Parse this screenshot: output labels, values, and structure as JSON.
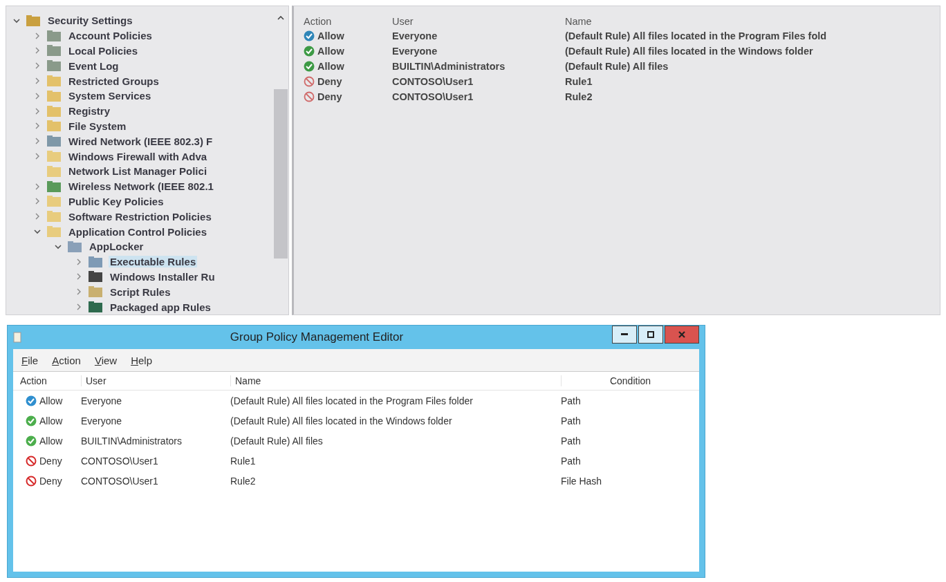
{
  "tree": {
    "items": [
      {
        "label": "Security Settings",
        "kind": "root",
        "expandable": true,
        "expanded": true,
        "selected": false,
        "children": [
          {
            "label": "Account Policies",
            "kind": "policy",
            "expandable": true,
            "expanded": false,
            "selected": false
          },
          {
            "label": "Local Policies",
            "kind": "policy",
            "expandable": true,
            "expanded": false,
            "selected": false
          },
          {
            "label": "Event Log",
            "kind": "policy",
            "expandable": true,
            "expanded": false,
            "selected": false
          },
          {
            "label": "Restricted Groups",
            "kind": "locked-folder",
            "expandable": true,
            "expanded": false,
            "selected": false
          },
          {
            "label": "System Services",
            "kind": "locked-folder",
            "expandable": true,
            "expanded": false,
            "selected": false
          },
          {
            "label": "Registry",
            "kind": "locked-folder",
            "expandable": true,
            "expanded": false,
            "selected": false
          },
          {
            "label": "File System",
            "kind": "locked-folder",
            "expandable": true,
            "expanded": false,
            "selected": false
          },
          {
            "label": "Wired Network (IEEE 802.3) F",
            "kind": "network",
            "expandable": true,
            "expanded": false,
            "selected": false
          },
          {
            "label": "Windows Firewall with Adva",
            "kind": "folder",
            "expandable": true,
            "expanded": false,
            "selected": false
          },
          {
            "label": "Network List Manager Polici",
            "kind": "folder",
            "expandable": false,
            "expanded": false,
            "selected": false
          },
          {
            "label": "Wireless Network (IEEE 802.1",
            "kind": "wireless",
            "expandable": true,
            "expanded": false,
            "selected": false
          },
          {
            "label": "Public Key Policies",
            "kind": "folder",
            "expandable": true,
            "expanded": false,
            "selected": false
          },
          {
            "label": "Software Restriction Policies",
            "kind": "folder",
            "expandable": true,
            "expanded": false,
            "selected": false
          },
          {
            "label": "Application Control Policies",
            "kind": "folder",
            "expandable": true,
            "expanded": true,
            "selected": false,
            "children": [
              {
                "label": "AppLocker",
                "kind": "applocker",
                "expandable": true,
                "expanded": true,
                "selected": false,
                "children": [
                  {
                    "label": "Executable Rules",
                    "kind": "window",
                    "expandable": true,
                    "expanded": false,
                    "selected": true
                  },
                  {
                    "label": "Windows Installer Ru",
                    "kind": "disc",
                    "expandable": true,
                    "expanded": false,
                    "selected": false
                  },
                  {
                    "label": "Script Rules",
                    "kind": "script",
                    "expandable": true,
                    "expanded": false,
                    "selected": false
                  },
                  {
                    "label": "Packaged app Rules",
                    "kind": "package",
                    "expandable": true,
                    "expanded": false,
                    "selected": false
                  }
                ]
              }
            ]
          }
        ]
      }
    ]
  },
  "rule_list": {
    "columns": [
      "Action",
      "User",
      "Name"
    ],
    "rows": [
      {
        "action": "Allow",
        "kind": "allow",
        "color": "#2f86b8",
        "user": "Everyone",
        "name": "(Default Rule) All files located in the Program Files fold"
      },
      {
        "action": "Allow",
        "kind": "allow",
        "color": "#3d9a45",
        "user": "Everyone",
        "name": "(Default Rule) All files located in the Windows folder"
      },
      {
        "action": "Allow",
        "kind": "allow",
        "color": "#3d9a45",
        "user": "BUILTIN\\Administrators",
        "name": "(Default Rule) All files"
      },
      {
        "action": "Deny",
        "kind": "deny",
        "color": "#d06a6a",
        "user": "CONTOSO\\User1",
        "name": "Rule1"
      },
      {
        "action": "Deny",
        "kind": "deny",
        "color": "#d06a6a",
        "user": "CONTOSO\\User1",
        "name": "Rule2"
      }
    ]
  },
  "window": {
    "title": "Group Policy Management Editor",
    "menu": [
      "File",
      "Action",
      "View",
      "Help"
    ],
    "columns": [
      "Action",
      "User",
      "Name",
      "Condition"
    ],
    "rows": [
      {
        "action": "Allow",
        "kind": "allow",
        "color": "#2f8fcf",
        "user": "Everyone",
        "name": "(Default Rule) All files located in the Program Files folder",
        "condition": "Path"
      },
      {
        "action": "Allow",
        "kind": "allow",
        "color": "#4cae4c",
        "user": "Everyone",
        "name": "(Default Rule) All files located in the Windows folder",
        "condition": "Path"
      },
      {
        "action": "Allow",
        "kind": "allow",
        "color": "#4cae4c",
        "user": "BUILTIN\\Administrators",
        "name": "(Default Rule) All files",
        "condition": "Path"
      },
      {
        "action": "Deny",
        "kind": "deny",
        "color": "#d62a2a",
        "user": "CONTOSO\\User1",
        "name": "Rule1",
        "condition": "Path"
      },
      {
        "action": "Deny",
        "kind": "deny",
        "color": "#d62a2a",
        "user": "CONTOSO\\User1",
        "name": "Rule2",
        "condition": "File Hash"
      }
    ]
  }
}
